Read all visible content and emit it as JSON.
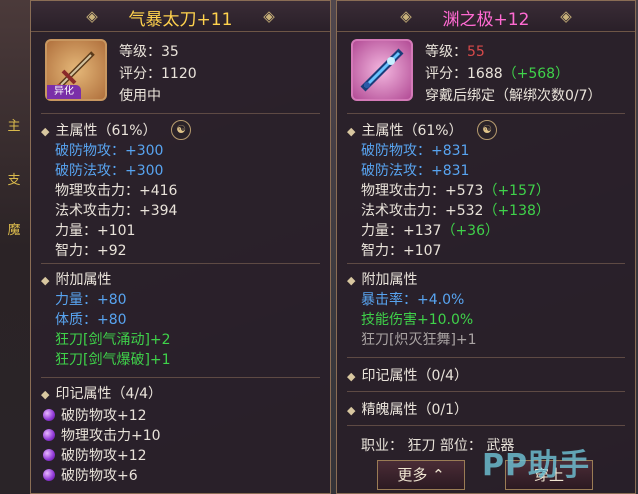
{
  "left": {
    "title": "气暴太刀+11",
    "title_color": "#ffd24d",
    "icon_badge": "异化",
    "level_label": "等级：",
    "level": "35",
    "score_label": "评分：",
    "score": "1120",
    "status": "使用中",
    "main": {
      "header": "主属性（61%）",
      "stats": [
        {
          "text": "破防物攻：+300",
          "color": "blue"
        },
        {
          "text": "破防法攻：+300",
          "color": "blue"
        },
        {
          "text": "物理攻击力：+416",
          "color": "white"
        },
        {
          "text": "法术攻击力：+394",
          "color": "white"
        },
        {
          "text": "力量：+101",
          "color": "white"
        },
        {
          "text": "智力：+92",
          "color": "white"
        }
      ]
    },
    "extra": {
      "header": "附加属性",
      "stats": [
        {
          "text": "力量：+80",
          "color": "blue"
        },
        {
          "text": "体质：+80",
          "color": "blue"
        },
        {
          "text": "狂刀[剑气涌动]+2",
          "color": "green"
        },
        {
          "text": "狂刀[剑气爆破]+1",
          "color": "green"
        }
      ]
    },
    "mark": {
      "header": "印记属性（4/4）",
      "stats": [
        "破防物攻+12",
        "物理攻击力+10",
        "破防物攻+12",
        "破防物攻+6"
      ]
    }
  },
  "right": {
    "title": "渊之极+12",
    "title_color": "#ff6ad2",
    "level_label": "等级：",
    "level": "55",
    "score_label": "评分：",
    "score": "1688",
    "score_bonus": "（+568）",
    "status": "穿戴后绑定（解绑次数0/7）",
    "main": {
      "header": "主属性（61%）",
      "stats": [
        {
          "text": "破防物攻：+831",
          "color": "blue",
          "bonus": ""
        },
        {
          "text": "破防法攻：+831",
          "color": "blue",
          "bonus": ""
        },
        {
          "text": "物理攻击力：+573",
          "color": "white",
          "bonus": "（+157）"
        },
        {
          "text": "法术攻击力：+532",
          "color": "white",
          "bonus": "（+138）"
        },
        {
          "text": "力量：+137",
          "color": "white",
          "bonus": "（+36）"
        },
        {
          "text": "智力：+107",
          "color": "white",
          "bonus": ""
        }
      ]
    },
    "extra": {
      "header": "附加属性",
      "stats": [
        {
          "text": "暴击率：+4.0%",
          "color": "blue"
        },
        {
          "text": "技能伤害+10.0%",
          "color": "green"
        },
        {
          "text": "狂刀[炽灭狂舞]+1",
          "color": "gray"
        }
      ]
    },
    "mark_header": "印记属性（0/4）",
    "soul_header": "精魄属性（0/1）",
    "job_line": "职业：  狂刀   部位：  武器",
    "more_button": "更多",
    "wear_button": "穿上"
  },
  "side_tags": [
    "主",
    "支",
    "魔"
  ],
  "watermark": "PP助手"
}
